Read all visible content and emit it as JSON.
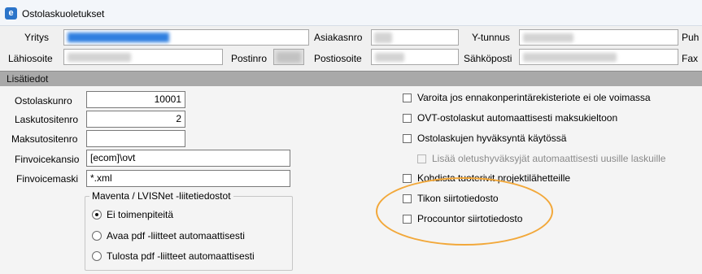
{
  "window": {
    "title": "Ostolaskuoletukset"
  },
  "company_info": {
    "yritys_label": "Yritys",
    "asiakasnro_label": "Asiakasnro",
    "ytunnus_label": "Y-tunnus",
    "puh_label": "Puh",
    "lahiosoite_label": "Lähiosoite",
    "postinro_label": "Postinro",
    "postiosoite_label": "Postiosoite",
    "sahkoposti_label": "Sähköposti",
    "fax_label": "Fax"
  },
  "section": {
    "title": "Lisätiedot"
  },
  "fields": {
    "ostolaskunro": {
      "label": "Ostolaskunro",
      "value": "10001"
    },
    "laskutositenro": {
      "label": "Laskutositenro",
      "value": "2"
    },
    "maksutositenro": {
      "label": "Maksutositenro",
      "value": ""
    },
    "finvoicekansio": {
      "label": "Finvoicekansio",
      "value": "[ecom]\\ovt"
    },
    "finvoicemaski": {
      "label": "Finvoicemaski",
      "value": "*.xml"
    }
  },
  "attachments_group": {
    "title": "Maventa / LVISNet -liitetiedostot",
    "options": [
      {
        "label": "Ei toimenpiteitä",
        "selected": true
      },
      {
        "label": "Avaa pdf -liitteet automaattisesti",
        "selected": false
      },
      {
        "label": "Tulosta pdf -liitteet automaattisesti",
        "selected": false
      }
    ]
  },
  "checkboxes": [
    {
      "label": "Varoita jos ennakonperintärekisteriote ei ole voimassa",
      "checked": false,
      "enabled": true
    },
    {
      "label": "OVT-ostolaskut automaattisesti maksukieltoon",
      "checked": false,
      "enabled": true
    },
    {
      "label": "Ostolaskujen hyväksyntä käytössä",
      "checked": false,
      "enabled": true
    },
    {
      "label": "Lisää oletushyväksyjät automaattisesti uusille laskuille",
      "checked": false,
      "enabled": false
    },
    {
      "label": "Kohdista tuoterivit projektilähetteille",
      "checked": false,
      "enabled": true
    },
    {
      "label": "Tikon siirtotiedosto",
      "checked": false,
      "enabled": true
    },
    {
      "label": "Procountor siirtotiedosto",
      "checked": false,
      "enabled": true
    }
  ],
  "colors": {
    "highlight": "#f2a83a",
    "section_header": "#a9a9a9",
    "blurred_value": "#2f7fe0"
  }
}
